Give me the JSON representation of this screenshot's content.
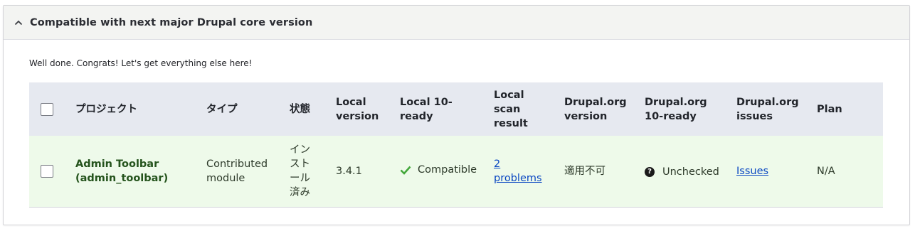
{
  "panel": {
    "title": "Compatible with next major Drupal core version",
    "intro": "Well done. Congrats! Let's get everything else here!"
  },
  "table": {
    "headers": {
      "project": "プロジェクト",
      "type": "タイプ",
      "status": "状態",
      "local_version": "Local version",
      "local_ready": "Local 10-ready",
      "local_scan": "Local scan result",
      "drupal_version": "Drupal.org version",
      "drupal_ready": "Drupal.org 10-ready",
      "drupal_issues": "Drupal.org issues",
      "plan": "Plan"
    },
    "rows": [
      {
        "project": "Admin Toolbar (admin_toolbar)",
        "type": "Contributed module",
        "status": "インストール済み",
        "local_version": "3.4.1",
        "local_ready": "Compatible",
        "local_scan": "2 problems",
        "drupal_version": "適用不可",
        "drupal_ready": "Unchecked",
        "drupal_issues": "Issues",
        "plan": "N/A"
      }
    ]
  },
  "icons": {
    "collapse": "chevron-up-icon",
    "compatible": "check-icon",
    "unchecked": "question-circle-icon"
  },
  "colors": {
    "header_bg": "#e6e9f0",
    "row_bg": "#eefaea",
    "project_text": "#24531c",
    "check": "#42a73a",
    "link": "#0a47c2"
  }
}
